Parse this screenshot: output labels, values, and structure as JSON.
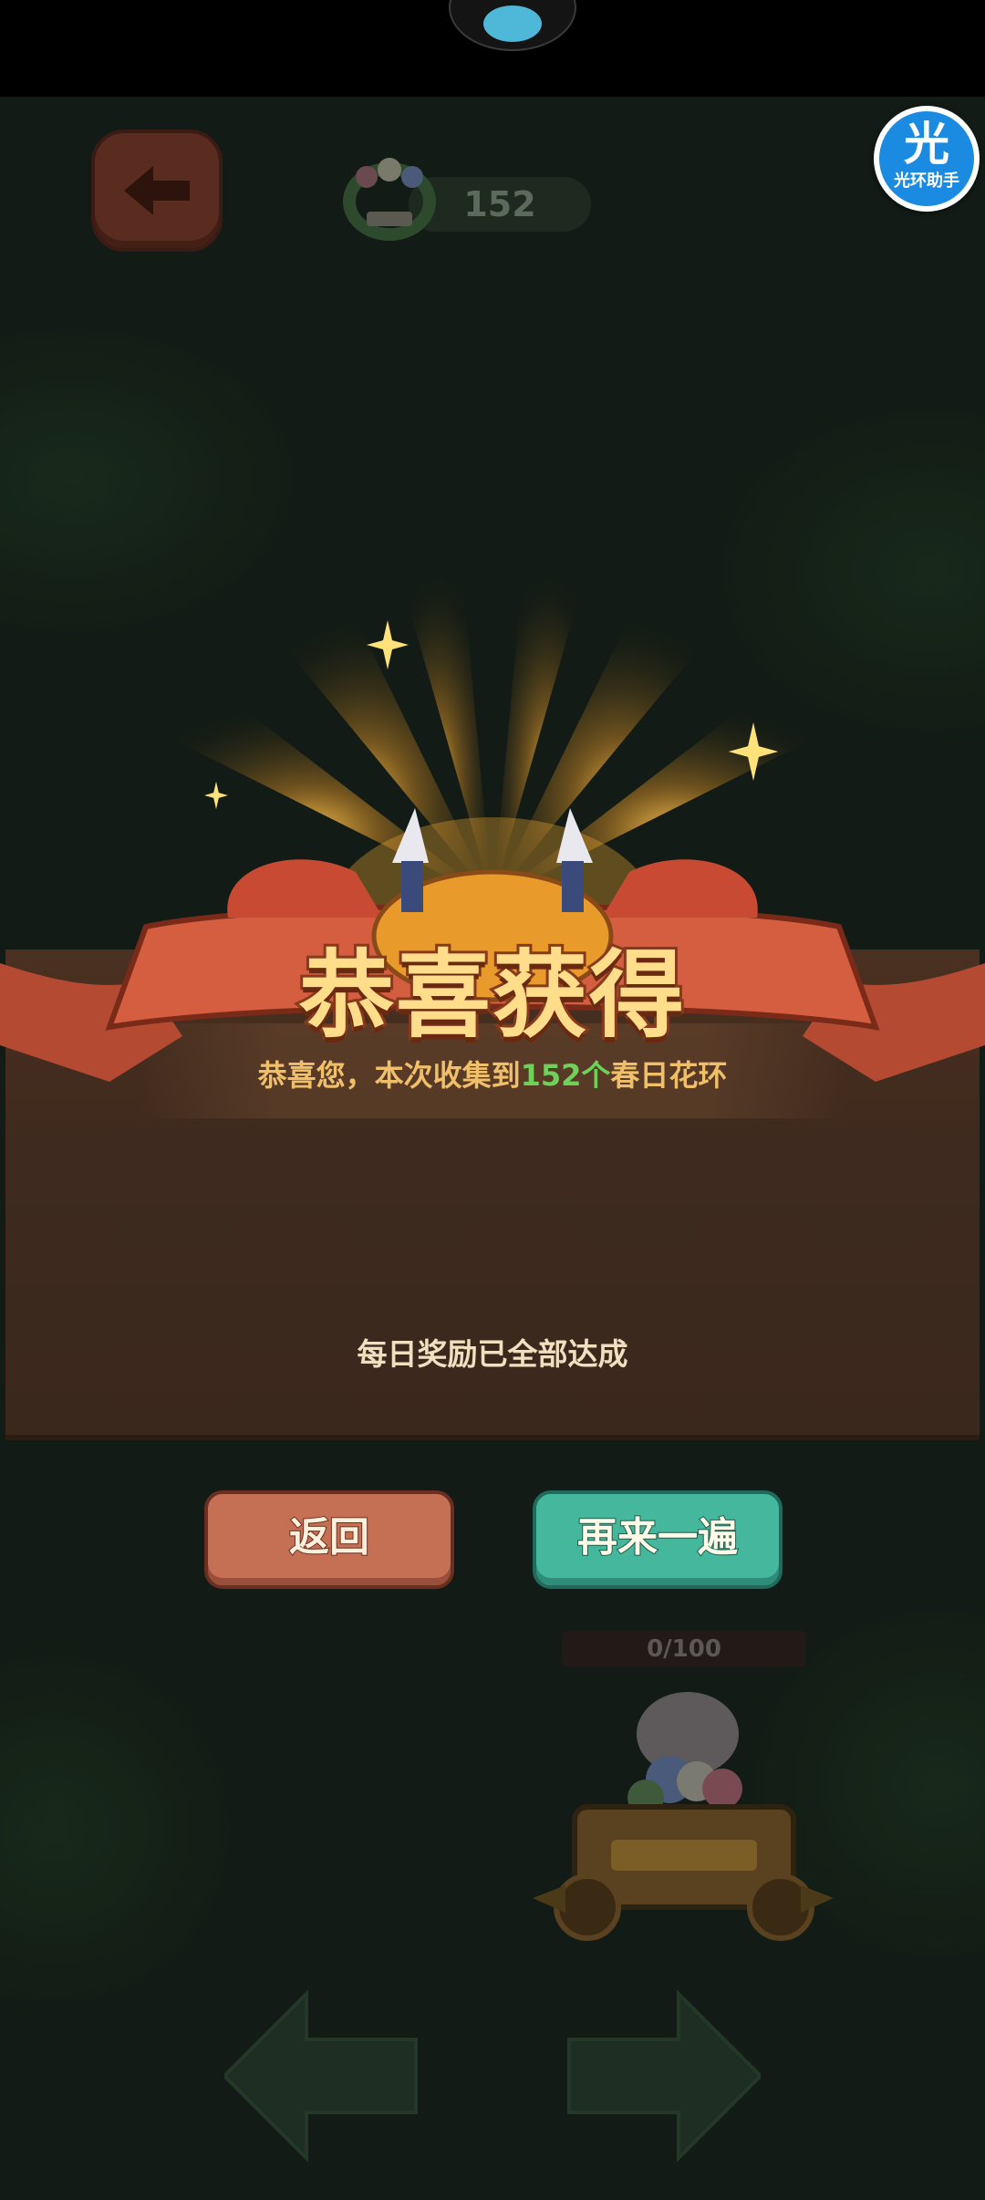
{
  "hud": {
    "wreath_count": "152",
    "assistant_badge": {
      "glyph": "光",
      "label": "光环助手"
    }
  },
  "reward": {
    "banner_title": "恭喜获得",
    "congrats_prefix": "恭喜您，本次收集到",
    "collected_count": "152个",
    "item_name": "春日花环",
    "daily_status": "每日奖励已全部达成"
  },
  "buttons": {
    "return_label": "返回",
    "again_label": "再来一遍"
  },
  "cart": {
    "progress_text": "0/100",
    "progress_fraction": 0
  },
  "icons": [
    "back-arrow-icon",
    "wreath-icon",
    "sparkle-icon",
    "cart-icon",
    "left-arrow-icon",
    "right-arrow-icon"
  ],
  "colors": {
    "accent_gold": "#f0bf6a",
    "count_green": "#6fd15a",
    "return_button": "#c56f54",
    "again_button": "#45b79d",
    "assistant_blue": "#1a8be0"
  }
}
